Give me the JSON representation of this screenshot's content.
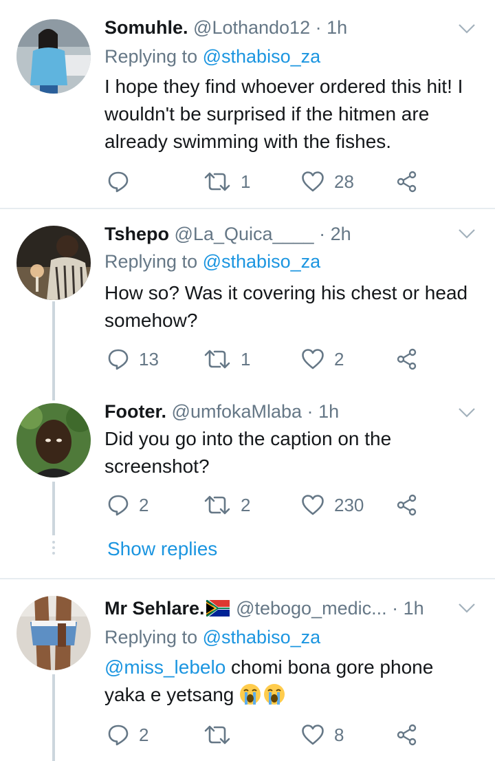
{
  "tweets": [
    {
      "name": "Somuhle.",
      "handle": "@Lothando12",
      "sep": "·",
      "time": "1h",
      "replying_prefix": "Replying to",
      "replying_to": "@sthabiso_za",
      "text": "I hope they find whoever ordered this hit! I wouldn't be surprised if the hitmen are already swimming with the fishes.",
      "replies": "",
      "retweets": "1",
      "likes": "28",
      "avatar_icon": "avatar-woman-blue-hoodie"
    },
    {
      "name": "Tshepo",
      "handle": "@La_Quica____",
      "sep": "·",
      "time": "2h",
      "replying_prefix": "Replying to",
      "replying_to": "@sthabiso_za",
      "text": "How so?  Was it covering his chest or head somehow?",
      "replies": "13",
      "retweets": "1",
      "likes": "2",
      "avatar_icon": "avatar-man-with-glass"
    },
    {
      "name": "Footer.",
      "handle": "@umfokaMlaba",
      "sep": "·",
      "time": "1h",
      "text": "Did you go into the caption on the screenshot?",
      "replies": "2",
      "retweets": "2",
      "likes": "230",
      "show_replies": "Show replies",
      "avatar_icon": "avatar-man-selfie"
    },
    {
      "name": "Mr Sehlare.",
      "name_flag": "south-africa-flag",
      "handle": "@tebogo_medic...",
      "sep": "·",
      "time": "1h",
      "replying_prefix": "Replying to",
      "replying_to": "@sthabiso_za",
      "mention": "@miss_lebelo",
      "text_rest": " chomi bona gore phone yaka e yetsang ",
      "emoji": [
        "loudly-crying-face",
        "loudly-crying-face"
      ],
      "replies": "2",
      "retweets": "",
      "likes": "8",
      "avatar_icon": "avatar-person-denim-shorts"
    }
  ],
  "colors": {
    "name": "#14171a",
    "secondary": "#657786",
    "link": "#1b95e0",
    "divider": "#e6ecf0",
    "thread_line": "#ccd6dd"
  }
}
